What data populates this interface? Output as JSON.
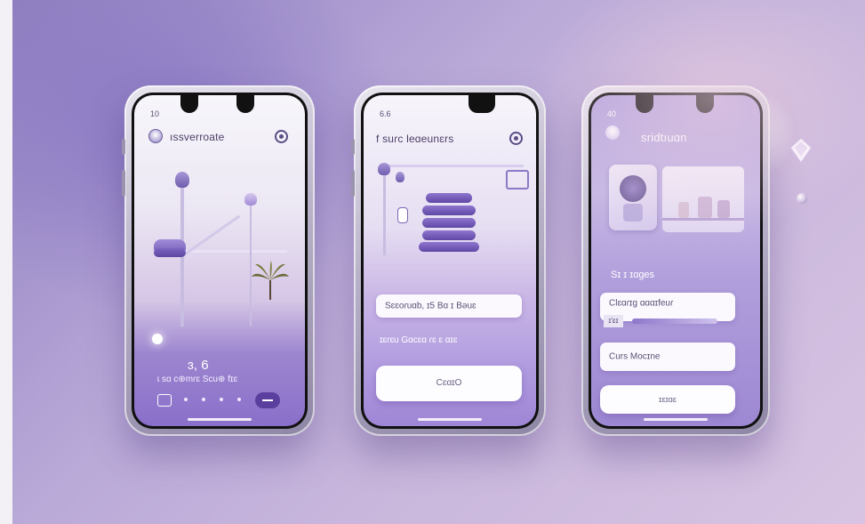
{
  "phones": [
    {
      "time": "10",
      "title": "ıssverroate",
      "stats": "ɜ, 6",
      "label": "ɩ sɑ c⊕mɾɛ Scu⊕ fɪɛ",
      "colors": {
        "accent": "#7c63c4"
      }
    },
    {
      "time": "6.6",
      "title": "f suɾc leɑeunɛrs",
      "input_text": "Sɛɛoɾuɑb, ɪ5 Bɑ ɪ Bǝuɛ",
      "link_text": "ɪɛɾɛu Gɑcɛɑ ɾɛ ɛ ɑɪɛ",
      "button_label": "CɛɑɪO",
      "colors": {
        "accent": "#9f86d6"
      }
    },
    {
      "time": "40",
      "title": "sridtıuɑn",
      "section_label": "Sɪ ɪ ɪɑges",
      "field_text": "Clɛɑɾɪg ɑɑɑɪfeuɾ",
      "chip_text": "ɪ'ɛɪ",
      "field2_text": "Curs Mocɪne",
      "button_label": "ɪɛɪɑɛ",
      "colors": {
        "accent": "#9d88d3"
      }
    }
  ],
  "icons": [
    "gem-icon",
    "pearl-icon",
    "user-avatar-icon",
    "profile-icon"
  ]
}
